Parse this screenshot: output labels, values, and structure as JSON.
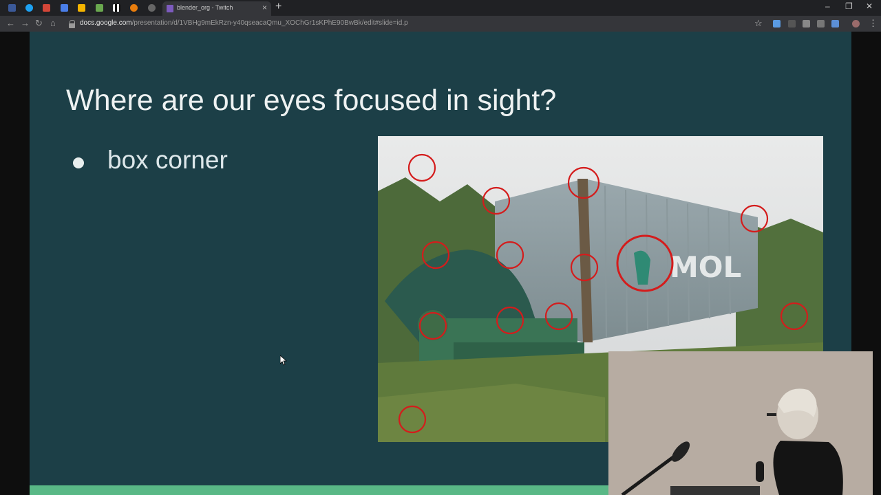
{
  "browser": {
    "tab_title": "blender_org - Twitch",
    "new_tab_glyph": "+",
    "close_glyph": "×",
    "url_host": "docs.google.com",
    "url_path": "/presentation/d/1VBHg9mEkRzn-y40qseacaQmu_XOChGr1sKPhE90BwBk/edit#slide=id.p"
  },
  "slide": {
    "title": "Where are our eyes focused in sight?",
    "bullets": [
      "box corner"
    ],
    "photo_text": "MOL"
  },
  "colors": {
    "slide_bg": "#1c3f47",
    "accent_bar": "#59b886",
    "focus_circle": "#d41c1c"
  },
  "icons": [
    "facebook-icon",
    "twitter-icon",
    "gmail-icon",
    "docs-icon",
    "slides-icon",
    "sheets-icon",
    "chess-icon",
    "blender-icon",
    "twitch-icon",
    "star-icon",
    "extension-icon"
  ]
}
